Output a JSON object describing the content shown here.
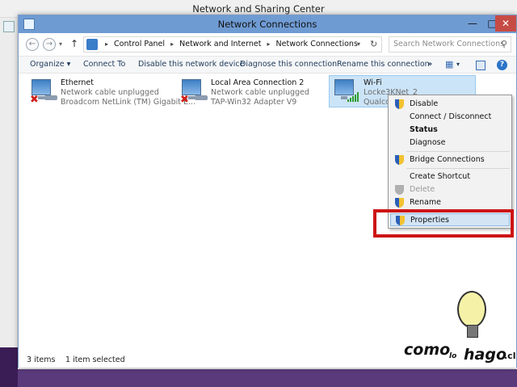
{
  "background_window": {
    "title": "Network and Sharing Center"
  },
  "window": {
    "title": "Network Connections",
    "minimize_glyph": "—",
    "maximize_glyph": "□",
    "close_glyph": "✕"
  },
  "address": {
    "back_glyph": "←",
    "forward_glyph": "→",
    "recent_glyph": "▾",
    "up_glyph": "↑",
    "crumbs": [
      "Control Panel",
      "Network and Internet",
      "Network Connections"
    ],
    "separator": "▸",
    "dropdown_glyph": "▾",
    "refresh_glyph": "↻"
  },
  "search": {
    "placeholder": "Search Network Connections",
    "icon_glyph": "⚲"
  },
  "commandbar": {
    "organize": "Organize  ▾",
    "connect_to": "Connect To",
    "disable": "Disable this network device",
    "diagnose": "Diagnose this connection",
    "rename": "Rename this connection",
    "more": "»",
    "view_glyph": "▦",
    "view_drop": "▾",
    "help_glyph": "?"
  },
  "connections": [
    {
      "name": "Ethernet",
      "status": "Network cable unplugged",
      "adapter": "Broadcom NetLink (TM) Gigabit E...",
      "state_glyph": "✖"
    },
    {
      "name": "Local Area Connection 2",
      "status": "Network cable unplugged",
      "adapter": "TAP-Win32 Adapter V9",
      "state_glyph": "✖"
    },
    {
      "name": "Wi-Fi",
      "status": "Locke3KNet_2",
      "adapter": "Qualcom"
    }
  ],
  "context_menu": {
    "items": [
      {
        "label": "Disable",
        "shield": true
      },
      {
        "label": "Connect / Disconnect",
        "shield": false
      },
      {
        "label": "Status",
        "shield": false,
        "bold": true
      },
      {
        "label": "Diagnose",
        "shield": false
      },
      {
        "label": "Bridge Connections",
        "shield": true
      },
      {
        "label": "Create Shortcut",
        "shield": false
      },
      {
        "label": "Delete",
        "shield": true,
        "disabled": true
      },
      {
        "label": "Rename",
        "shield": true
      },
      {
        "label": "Properties",
        "shield": true,
        "hover": true
      }
    ]
  },
  "statusbar": {
    "count": "3 items",
    "selection": "1 item selected"
  },
  "watermark": {
    "word1": "como",
    "word2": "lo",
    "word3": "hago",
    "suffix": ".cl"
  },
  "colors": {
    "titlebar": "#6f9bd3",
    "selection": "#cce4f7",
    "highlight_border": "#cc1414",
    "close_button": "#c74b45"
  }
}
